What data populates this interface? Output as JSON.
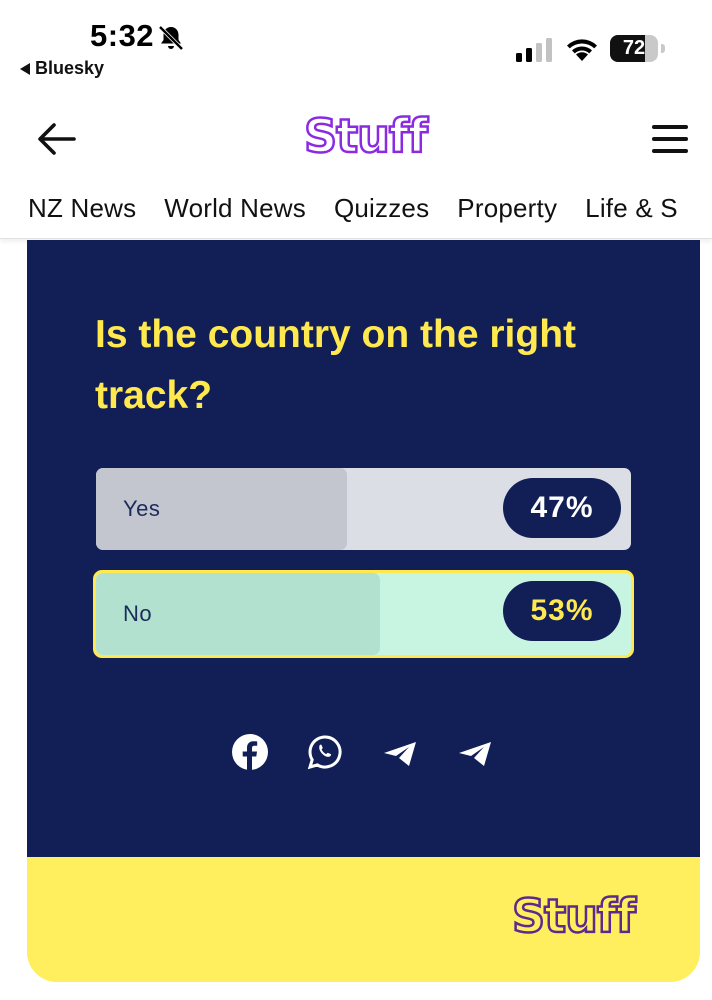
{
  "status_bar": {
    "time": "5:32",
    "back_app": "Bluesky",
    "battery": "72",
    "battery_level": 0.72
  },
  "header": {
    "logo": "Stuff"
  },
  "nav": {
    "items": [
      "NZ News",
      "World News",
      "Quizzes",
      "Property",
      "Life & S"
    ]
  },
  "poll": {
    "question": "Is the country on the right track?",
    "options": [
      {
        "label": "Yes",
        "percent_label": "47%",
        "percent": 47,
        "selected": false
      },
      {
        "label": "No",
        "percent_label": "53%",
        "percent": 53,
        "selected": true
      }
    ]
  },
  "share": {
    "icons": [
      "facebook-icon",
      "whatsapp-icon",
      "telegram-icon",
      "telegram-icon"
    ]
  },
  "footer": {
    "logo": "Stuff"
  },
  "colors": {
    "navy": "#121f57",
    "yellow": "#ffe94e",
    "footer_yellow": "#ffef5e",
    "logo_purple": "#8a2be2",
    "mint": "#c8f4e2",
    "grey": "#dcdee6"
  }
}
